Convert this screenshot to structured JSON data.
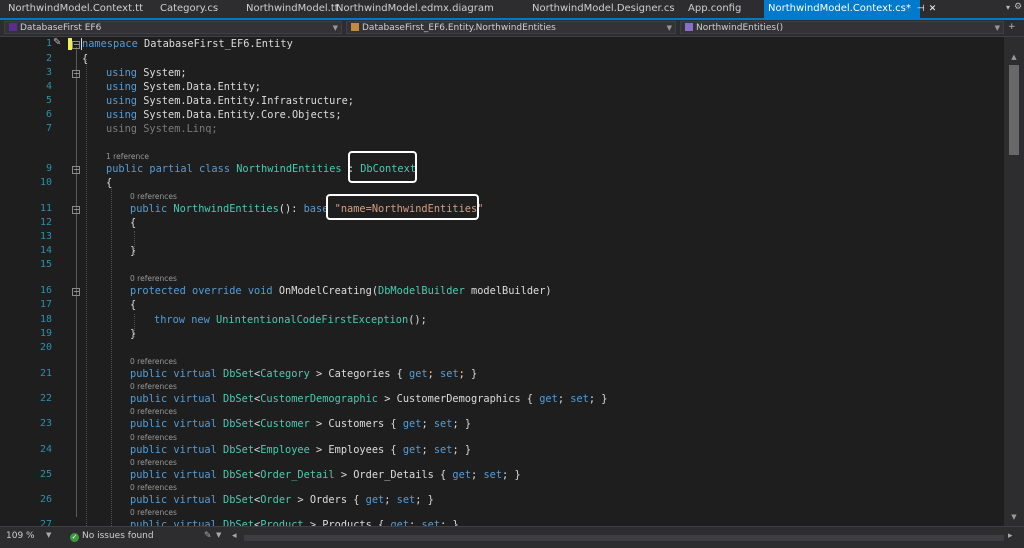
{
  "tabs": [
    {
      "label": "NorthwindModel.Context.tt"
    },
    {
      "label": "Category.cs"
    },
    {
      "label": "NorthwindModel.tt"
    },
    {
      "label": "NorthwindModel.edmx.diagram"
    },
    {
      "label": "NorthwindModel.Designer.cs"
    },
    {
      "label": "App.config"
    },
    {
      "label": "NorthwindModel.Context.cs*",
      "active": true
    }
  ],
  "navbar": {
    "project": "DatabaseFirst EF6",
    "class": "DatabaseFirst_EF6.Entity.NorthwindEntities",
    "member": "NorthwindEntities()"
  },
  "editor": {
    "lines": [
      {
        "n": "1",
        "t": [
          [
            "kw",
            "namespace"
          ],
          [
            "",
            "DatabaseFirst_EF6.Entity"
          ]
        ]
      },
      {
        "n": "2",
        "t": [
          [
            "",
            "{"
          ]
        ]
      },
      {
        "n": "3",
        "t": [
          [
            "kw",
            "using"
          ],
          [
            "",
            "System;"
          ]
        ]
      },
      {
        "n": "4",
        "t": [
          [
            "kw",
            "using"
          ],
          [
            "",
            "System.Data.Entity;"
          ]
        ]
      },
      {
        "n": "5",
        "t": [
          [
            "kw",
            "using"
          ],
          [
            "",
            "System.Data.Entity.Infrastructure;"
          ]
        ]
      },
      {
        "n": "6",
        "t": [
          [
            "kw",
            "using"
          ],
          [
            "",
            "System.Data.Entity.Core.Objects;"
          ]
        ]
      },
      {
        "n": "7",
        "t": [
          [
            "using-dim",
            "using System.Linq;"
          ]
        ]
      },
      {
        "n": "9",
        "t": [
          [
            "kw",
            "public"
          ],
          [
            "kw",
            "partial"
          ],
          [
            "kw",
            "class"
          ],
          [
            "ty",
            "NorthwindEntities"
          ],
          [
            "",
            ":"
          ],
          [
            "ty",
            "DbContext"
          ]
        ]
      },
      {
        "n": "10",
        "t": [
          [
            "",
            "{"
          ]
        ]
      },
      {
        "n": "11",
        "t": [
          [
            "kw",
            "public"
          ],
          [
            "ty",
            "NorthwindEntities"
          ],
          [
            "",
            "():"
          ],
          [
            "kw",
            "base"
          ],
          [
            "str",
            "\"name=NorthwindEntities\""
          ]
        ]
      },
      {
        "n": "12",
        "t": [
          [
            "",
            "{"
          ]
        ]
      },
      {
        "n": "13",
        "t": []
      },
      {
        "n": "14",
        "t": [
          [
            "",
            "}"
          ]
        ]
      },
      {
        "n": "15",
        "t": []
      },
      {
        "n": "16",
        "t": [
          [
            "kw",
            "protected"
          ],
          [
            "kw",
            "override"
          ],
          [
            "kw",
            "void"
          ],
          [
            "",
            "OnModelCreating("
          ],
          [
            "ty",
            "DbModelBuilder"
          ],
          [
            "",
            "modelBuilder)"
          ]
        ]
      },
      {
        "n": "17",
        "t": [
          [
            "",
            "{"
          ]
        ]
      },
      {
        "n": "18",
        "t": [
          [
            "kw",
            "throw"
          ],
          [
            "kw",
            "new"
          ],
          [
            "ty",
            "UnintentionalCodeFirstException"
          ],
          [
            "",
            "();"
          ]
        ]
      },
      {
        "n": "19",
        "t": [
          [
            "",
            "}"
          ]
        ]
      },
      {
        "n": "20",
        "t": []
      },
      {
        "n": "21",
        "t": [
          [
            "kw",
            "public"
          ],
          [
            "kw",
            "virtual"
          ],
          [
            "ty",
            "DbSet"
          ],
          [
            "",
            "<"
          ],
          [
            "ty",
            "Category"
          ],
          [
            "",
            "> Categories {"
          ],
          [
            "kw",
            "get"
          ],
          [
            "",
            ";"
          ],
          [
            "kw",
            "set"
          ],
          [
            "",
            "; }"
          ]
        ]
      },
      {
        "n": "22",
        "t": [
          [
            "kw",
            "public"
          ],
          [
            "kw",
            "virtual"
          ],
          [
            "ty",
            "DbSet"
          ],
          [
            "",
            "<"
          ],
          [
            "ty",
            "CustomerDemographic"
          ],
          [
            "",
            "> CustomerDemographics {"
          ],
          [
            "kw",
            "get"
          ],
          [
            "",
            ";"
          ],
          [
            "kw",
            "set"
          ],
          [
            "",
            "; }"
          ]
        ]
      },
      {
        "n": "23",
        "t": [
          [
            "kw",
            "public"
          ],
          [
            "kw",
            "virtual"
          ],
          [
            "ty",
            "DbSet"
          ],
          [
            "",
            "<"
          ],
          [
            "ty",
            "Customer"
          ],
          [
            "",
            "> Customers {"
          ],
          [
            "kw",
            "get"
          ],
          [
            "",
            ";"
          ],
          [
            "kw",
            "set"
          ],
          [
            "",
            "; }"
          ]
        ]
      },
      {
        "n": "24",
        "t": [
          [
            "kw",
            "public"
          ],
          [
            "kw",
            "virtual"
          ],
          [
            "ty",
            "DbSet"
          ],
          [
            "",
            "<"
          ],
          [
            "ty",
            "Employee"
          ],
          [
            "",
            "> Employees {"
          ],
          [
            "kw",
            "get"
          ],
          [
            "",
            ";"
          ],
          [
            "kw",
            "set"
          ],
          [
            "",
            "; }"
          ]
        ]
      },
      {
        "n": "25",
        "t": [
          [
            "kw",
            "public"
          ],
          [
            "kw",
            "virtual"
          ],
          [
            "ty",
            "DbSet"
          ],
          [
            "",
            "<"
          ],
          [
            "ty",
            "Order_Detail"
          ],
          [
            "",
            "> Order_Details {"
          ],
          [
            "kw",
            "get"
          ],
          [
            "",
            ";"
          ],
          [
            "kw",
            "set"
          ],
          [
            "",
            "; }"
          ]
        ]
      },
      {
        "n": "26",
        "t": [
          [
            "kw",
            "public"
          ],
          [
            "kw",
            "virtual"
          ],
          [
            "ty",
            "DbSet"
          ],
          [
            "",
            "<"
          ],
          [
            "ty",
            "Order"
          ],
          [
            "",
            "> Orders {"
          ],
          [
            "kw",
            "get"
          ],
          [
            "",
            ";"
          ],
          [
            "kw",
            "set"
          ],
          [
            "",
            "; }"
          ]
        ]
      },
      {
        "n": "27",
        "t": [
          [
            "kw",
            "public"
          ],
          [
            "kw",
            "virtual"
          ],
          [
            "ty",
            "DbSet"
          ],
          [
            "",
            "<"
          ],
          [
            "ty",
            "Product"
          ],
          [
            "",
            "> Products {"
          ],
          [
            "kw",
            "get"
          ],
          [
            "",
            ";"
          ],
          [
            "kw",
            "set"
          ],
          [
            "",
            "; }"
          ]
        ]
      }
    ],
    "codelens": {
      "one_ref": "1 reference",
      "zero_refs": "0 references"
    }
  },
  "statusbar": {
    "zoom": "109 %",
    "issues": "No issues found"
  },
  "colors": {
    "keyword": "#569cd6",
    "type": "#4ec9b0",
    "string": "#d69d85",
    "accent": "#007acc"
  }
}
